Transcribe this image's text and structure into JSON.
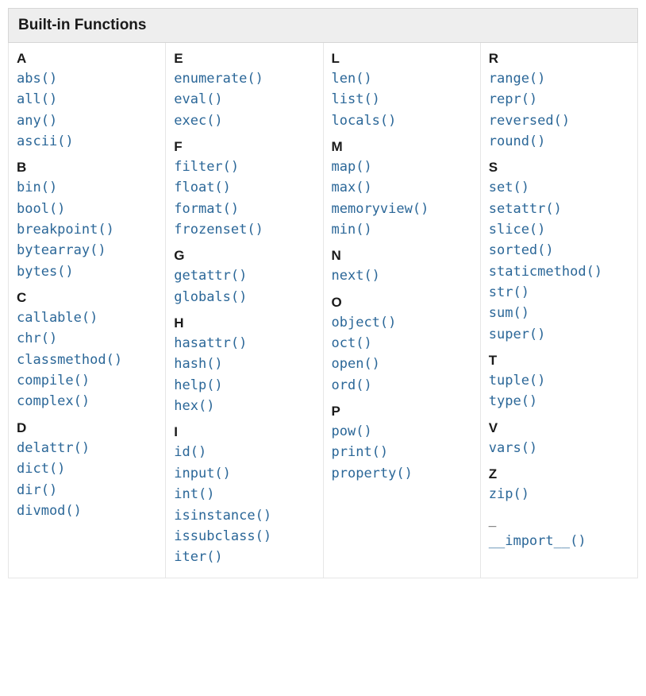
{
  "title": "Built-in Functions",
  "columns": [
    [
      {
        "letter": "A",
        "functions": [
          "abs()",
          "all()",
          "any()",
          "ascii()"
        ]
      },
      {
        "letter": "B",
        "functions": [
          "bin()",
          "bool()",
          "breakpoint()",
          "bytearray()",
          "bytes()"
        ]
      },
      {
        "letter": "C",
        "functions": [
          "callable()",
          "chr()",
          "classmethod()",
          "compile()",
          "complex()"
        ]
      },
      {
        "letter": "D",
        "functions": [
          "delattr()",
          "dict()",
          "dir()",
          "divmod()"
        ]
      }
    ],
    [
      {
        "letter": "E",
        "functions": [
          "enumerate()",
          "eval()",
          "exec()"
        ]
      },
      {
        "letter": "F",
        "functions": [
          "filter()",
          "float()",
          "format()",
          "frozenset()"
        ]
      },
      {
        "letter": "G",
        "functions": [
          "getattr()",
          "globals()"
        ]
      },
      {
        "letter": "H",
        "functions": [
          "hasattr()",
          "hash()",
          "help()",
          "hex()"
        ]
      },
      {
        "letter": "I",
        "functions": [
          "id()",
          "input()",
          "int()",
          "isinstance()",
          "issubclass()",
          "iter()"
        ]
      }
    ],
    [
      {
        "letter": "L",
        "functions": [
          "len()",
          "list()",
          "locals()"
        ]
      },
      {
        "letter": "M",
        "functions": [
          "map()",
          "max()",
          "memoryview()",
          "min()"
        ]
      },
      {
        "letter": "N",
        "functions": [
          "next()"
        ]
      },
      {
        "letter": "O",
        "functions": [
          "object()",
          "oct()",
          "open()",
          "ord()"
        ]
      },
      {
        "letter": "P",
        "functions": [
          "pow()",
          "print()",
          "property()"
        ]
      }
    ],
    [
      {
        "letter": "R",
        "functions": [
          "range()",
          "repr()",
          "reversed()",
          "round()"
        ]
      },
      {
        "letter": "S",
        "functions": [
          "set()",
          "setattr()",
          "slice()",
          "sorted()",
          "staticmethod()",
          "str()",
          "sum()",
          "super()"
        ]
      },
      {
        "letter": "T",
        "functions": [
          "tuple()",
          "type()"
        ]
      },
      {
        "letter": "V",
        "functions": [
          "vars()"
        ]
      },
      {
        "letter": "Z",
        "functions": [
          "zip()"
        ]
      },
      {
        "letter": "_",
        "functions": [
          "__import__()"
        ]
      }
    ]
  ]
}
